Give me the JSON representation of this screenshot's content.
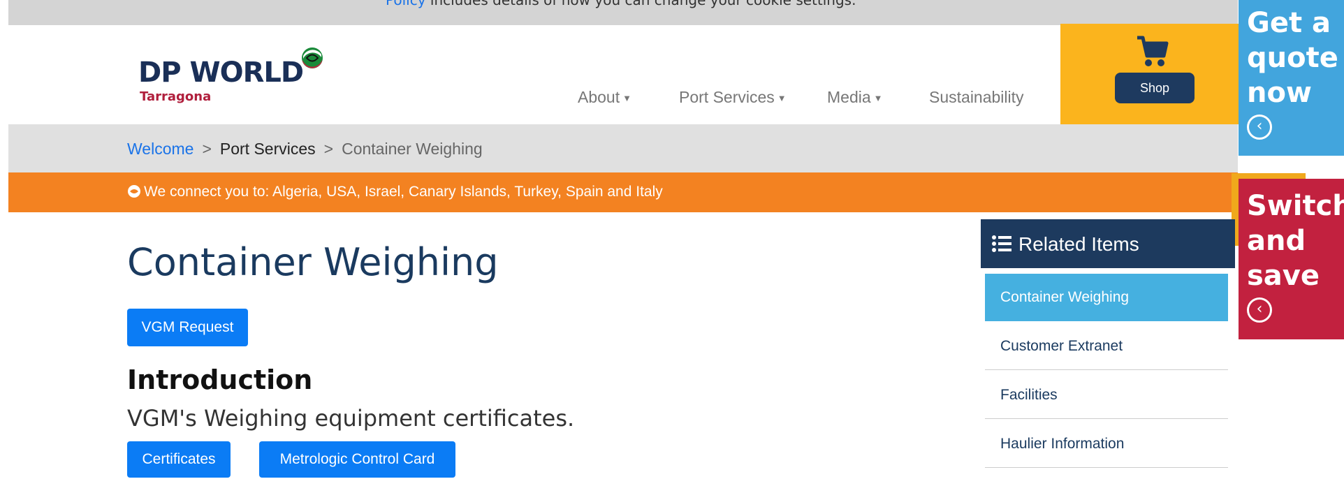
{
  "cookie": {
    "link": "Policy",
    "text": " includes details of how you can change your cookie settings."
  },
  "logo": {
    "brand": "DP WORLD",
    "sub": "Tarragona"
  },
  "nav": {
    "items": [
      {
        "label": "About",
        "has_menu": true
      },
      {
        "label": "Port Services",
        "has_menu": true
      },
      {
        "label": "Media",
        "has_menu": true
      },
      {
        "label": "Sustainability",
        "has_menu": false
      }
    ]
  },
  "shop": {
    "label": "Shop"
  },
  "promos": {
    "quote": {
      "lines": [
        "Get a",
        "quote",
        "now"
      ]
    },
    "switch": {
      "lines": [
        "Switch",
        "and",
        "save"
      ]
    }
  },
  "breadcrumb": {
    "items": [
      "Welcome",
      "Port Services",
      "Container Weighing"
    ],
    "separator": ">"
  },
  "banner": {
    "text": "We connect you to: Algeria, USA, Israel, Canary Islands, Turkey, Spain and Italy"
  },
  "main": {
    "title": "Container Weighing",
    "vgm_button": "VGM Request",
    "intro_heading": "Introduction",
    "intro_text": "VGM's Weighing equipment certificates.",
    "certificates_button": "Certificates",
    "metrologic_button": "Metrologic Control Card"
  },
  "related": {
    "title": "Related Items",
    "items": [
      "Container Weighing",
      "Customer Extranet",
      "Facilities",
      "Haulier Information"
    ]
  },
  "colors": {
    "orange": "#f38221",
    "navy": "#1d3a5e",
    "shop_yellow": "#fbb41d",
    "quote_blue": "#42a5dd",
    "switch_red": "#c2213f",
    "button_blue": "#0b7cf5"
  }
}
